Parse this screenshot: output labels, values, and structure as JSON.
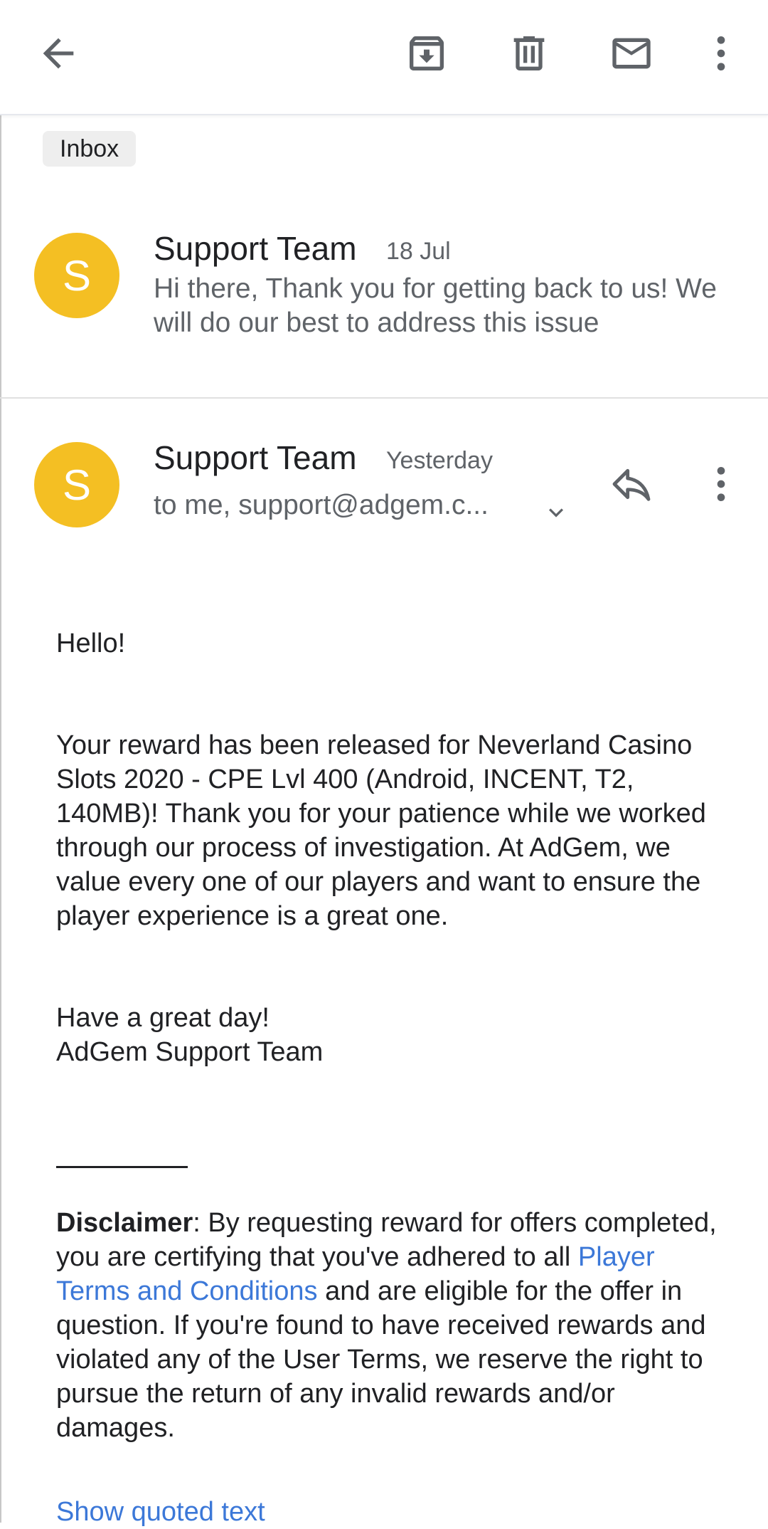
{
  "toolbar": {
    "back_icon": "arrow-back-icon",
    "archive_icon": "archive-icon",
    "delete_icon": "trash-icon",
    "mark_unread_icon": "mail-icon",
    "more_icon": "more-vert-icon"
  },
  "label": "Inbox",
  "thread": [
    {
      "avatar_letter": "S",
      "sender": "Support Team",
      "date": "18 Jul",
      "snippet": "Hi there, Thank you for getting back to us! We will do our best to address this issue"
    },
    {
      "avatar_letter": "S",
      "sender": "Support Team",
      "date": "Yesterday",
      "recipients": "to me, support@adgem.c..."
    }
  ],
  "body": {
    "greeting": "Hello!",
    "paragraph": "Your reward has been released for Neverland Casino Slots 2020 - CPE Lvl 400 (Android, INCENT, T2, 140MB)! Thank you for your patience while we worked through our process of investigation. At AdGem, we value every one of our players and want to ensure the player experience is a great one.",
    "closing_line1": "Have a great day!",
    "closing_line2": "AdGem Support Team",
    "disclaimer_label": "Disclaimer",
    "disclaimer_part1": ": By requesting reward for offers completed, you are certifying that you've adhered to all ",
    "disclaimer_link": "Player Terms and Conditions",
    "disclaimer_part2": " and are eligible for the offer in question. If you're found to have received rewards and violated any of the User Terms, we reserve the right to pursue the return of any invalid rewards and/or damages.",
    "show_quoted": "Show quoted text"
  },
  "colors": {
    "avatar": "#f4bf23",
    "link": "#3c78d8",
    "secondary_text": "#5f6368"
  }
}
